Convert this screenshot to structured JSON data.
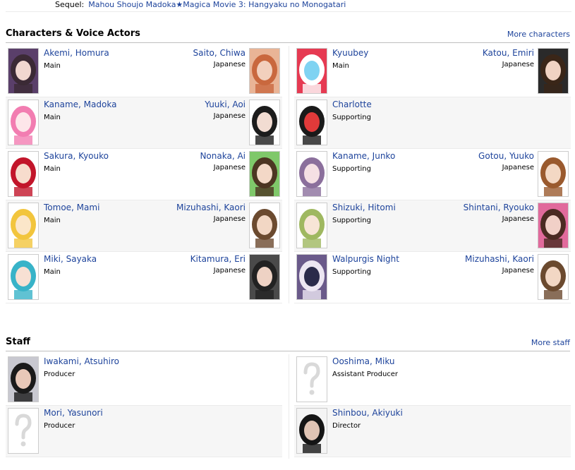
{
  "related": {
    "label": "Sequel:",
    "value": "Mahou Shoujo Madoka★Magica Movie 3: Hangyaku no Monogatari"
  },
  "characters_section": {
    "title": "Characters & Voice Actors",
    "more": "More characters"
  },
  "characters_left": [
    {
      "name": "Akemi, Homura",
      "role": "Main",
      "va": "Saito, Chiwa",
      "lang": "Japanese",
      "char_colors": [
        "#3b2a35",
        "#f1d7d0",
        "#5a3f6a"
      ],
      "va_colors": [
        "#c9683e",
        "#f2d0bd",
        "#e9b496"
      ]
    },
    {
      "name": "Kaname, Madoka",
      "role": "Main",
      "va": "Yuuki, Aoi",
      "lang": "Japanese",
      "char_colors": [
        "#f27db1",
        "#fde6ea",
        "#ffffff"
      ],
      "va_colors": [
        "#1c1c1c",
        "#f2dcd2",
        "#ffffff"
      ]
    },
    {
      "name": "Sakura, Kyouko",
      "role": "Main",
      "va": "Nonaka, Ai",
      "lang": "Japanese",
      "char_colors": [
        "#c2152a",
        "#f7dccd",
        "#ffffff"
      ],
      "va_colors": [
        "#4c3522",
        "#f3d8c7",
        "#7fc86a"
      ]
    },
    {
      "name": "Tomoe, Mami",
      "role": "Main",
      "va": "Mizuhashi, Kaori",
      "lang": "Japanese",
      "char_colors": [
        "#f2c53d",
        "#fbe6c9",
        "#ffffff"
      ],
      "va_colors": [
        "#6b4a2f",
        "#f2d7c4",
        "#ffffff"
      ]
    },
    {
      "name": "Miki, Sayaka",
      "role": "Main",
      "va": "Kitamura, Eri",
      "lang": "Japanese",
      "char_colors": [
        "#38b3c8",
        "#f7e0d3",
        "#ffffff"
      ],
      "va_colors": [
        "#222222",
        "#eed2c4",
        "#4a4a4a"
      ]
    }
  ],
  "characters_right": [
    {
      "name": "Kyuubey",
      "role": "Main",
      "va": "Katou, Emiri",
      "lang": "Japanese",
      "char_colors": [
        "#ffffff",
        "#7fd3f2",
        "#e63a52"
      ],
      "va_colors": [
        "#3a2618",
        "#f0d3c3",
        "#2a2a2a"
      ]
    },
    {
      "name": "Charlotte",
      "role": "Supporting",
      "va": "",
      "lang": "",
      "char_colors": [
        "#1a1a1a",
        "#e13a3a",
        "#ffffff"
      ],
      "va_colors": []
    },
    {
      "name": "Kaname, Junko",
      "role": "Supporting",
      "va": "Gotou, Yuuko",
      "lang": "Japanese",
      "char_colors": [
        "#8b6f9c",
        "#f5e0e4",
        "#ffffff"
      ],
      "va_colors": [
        "#9a5a2e",
        "#f3d8c4",
        "#ffffff"
      ]
    },
    {
      "name": "Shizuki, Hitomi",
      "role": "Supporting",
      "va": "Shintani, Ryouko",
      "lang": "Japanese",
      "char_colors": [
        "#9fb860",
        "#f7e5d6",
        "#ffffff"
      ],
      "va_colors": [
        "#4a2a22",
        "#f1d0c7",
        "#e16a9c"
      ]
    },
    {
      "name": "Walpurgis Night",
      "role": "Supporting",
      "va": "Mizuhashi, Kaori",
      "lang": "Japanese",
      "char_colors": [
        "#ece6f2",
        "#2a2a4a",
        "#6a5a8a"
      ],
      "va_colors": [
        "#6b4a2f",
        "#f2d7c4",
        "#ffffff"
      ]
    }
  ],
  "staff_section": {
    "title": "Staff",
    "more": "More staff"
  },
  "staff_left": [
    {
      "name": "Iwakami, Atsuhiro",
      "role": "Producer",
      "photo": "person",
      "colors": [
        "#1a1a1a",
        "#e8c8b8",
        "#c8c8d0"
      ]
    },
    {
      "name": "Mori, Yasunori",
      "role": "Producer",
      "photo": "placeholder",
      "colors": []
    }
  ],
  "staff_right": [
    {
      "name": "Ooshima, Miku",
      "role": "Assistant Producer",
      "photo": "placeholder",
      "colors": []
    },
    {
      "name": "Shinbou, Akiyuki",
      "role": "Director",
      "photo": "person",
      "colors": [
        "#151515",
        "#e0c4b4",
        "#f4f4f4"
      ]
    }
  ],
  "colors": {
    "link": "#1d439b",
    "alt_row": "#f6f6f6",
    "divider": "#ebebeb",
    "section_rule": "#bebebe",
    "placeholder": "#d9d9d9"
  }
}
